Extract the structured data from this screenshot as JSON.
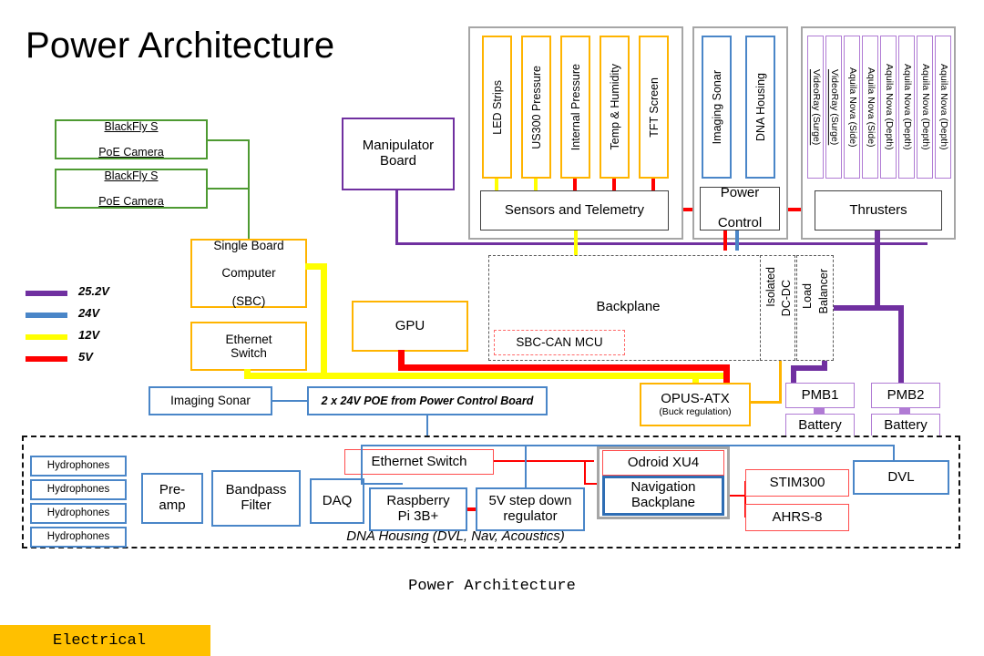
{
  "title": "Power Architecture",
  "caption": "Power Architecture",
  "tag_chip": {
    "label": "Electrical",
    "color": "#FFC000"
  },
  "legend": {
    "items": [
      {
        "label": "25.2V",
        "color": "#7030A0"
      },
      {
        "label": "24V",
        "color": "#4A86C8"
      },
      {
        "label": "12V",
        "color": "#FFFF00"
      },
      {
        "label": "5V",
        "color": "#FF0000"
      }
    ]
  },
  "cameras": [
    {
      "line1": "BlackFly S",
      "line2": "PoE Camera"
    },
    {
      "line1": "BlackFly S",
      "line2": "PoE Camera"
    }
  ],
  "manipulator_board": "Manipulator\nBoard",
  "sbc": {
    "line1": "Single Board",
    "line2": "Computer",
    "line3": "(SBC)"
  },
  "ethernet_switch_top": "Ethernet\nSwitch",
  "gpu": "GPU",
  "imaging_sonar_left": "Imaging Sonar",
  "poe_note": "2 x 24V POE from Power Control Board",
  "sensors_group": {
    "modules": [
      "LED Strips",
      "US300 Pressure",
      "Internal Pressure",
      "Temp & Humidity",
      "TFT Screen"
    ],
    "module_wire_colors": [
      "#FFFF00",
      "#FFFF00",
      "#FF0000",
      "#FF0000",
      "#FF0000"
    ],
    "footer": "Sensors and Telemetry"
  },
  "power_control_group": {
    "modules": [
      "Imaging Sonar",
      "DNA Housing"
    ],
    "footer_line1": "Power",
    "footer_line2": "Control"
  },
  "thrusters_group": {
    "modules": [
      "VideoRay (Surge)",
      "VideoRay (Surge)",
      "Aquila Nova (Side)",
      "Aquila Nova (Side)",
      "Aquila Nova (Depth)",
      "Aquila Nova (Depth)",
      "Aquila Nova (Depth)",
      "Aquila Nova (Depth)"
    ],
    "footer": "Thrusters"
  },
  "backplane": {
    "label": "Backplane",
    "mcu": "SBC-CAN MCU",
    "isolated_dcdc_l1": "Isolated",
    "isolated_dcdc_l2": "DC-DC",
    "load_balancer_l1": "Load",
    "load_balancer_l2": "Balancer"
  },
  "opus": {
    "title": "OPUS-ATX",
    "subtitle": "(Buck regulation)"
  },
  "pmb": [
    {
      "label": "PMB1",
      "battery": "Battery"
    },
    {
      "label": "PMB2",
      "battery": "Battery"
    }
  ],
  "dna_housing": {
    "caption": "DNA Housing (DVL, Nav, Acoustics)",
    "hydrophones": [
      "Hydrophones",
      "Hydrophones",
      "Hydrophones",
      "Hydrophones"
    ],
    "preamp": "Pre-\namp",
    "bandpass": "Bandpass\nFilter",
    "daq": "DAQ",
    "rpi": "Raspberry\nPi 3B+",
    "regulator": "5V step down\nregulator",
    "ethernet_switch": "Ethernet Switch",
    "odroid": "Odroid XU4",
    "nav_backplane": "Navigation\nBackplane",
    "stim": "STIM300",
    "ahrs": "AHRS-8",
    "dvl": "DVL"
  }
}
